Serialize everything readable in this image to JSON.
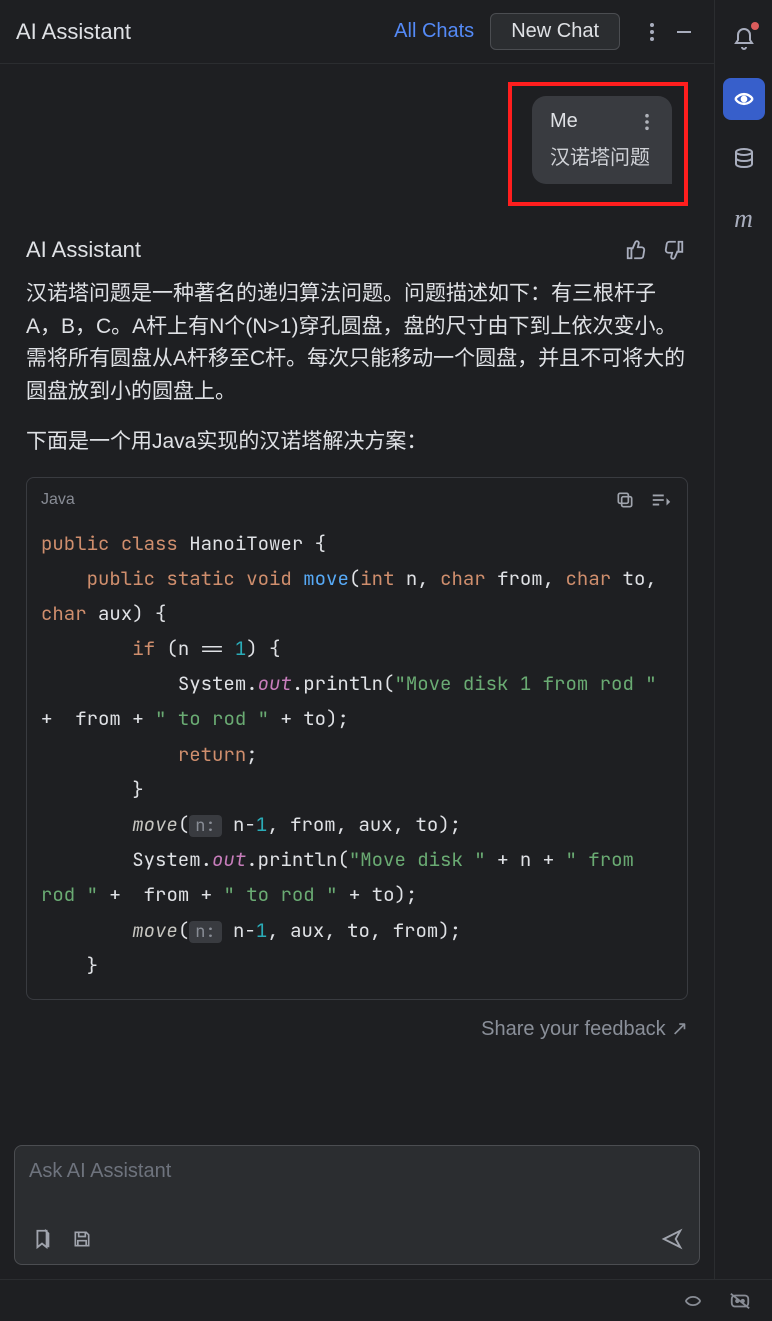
{
  "header": {
    "title": "AI Assistant",
    "all_chats": "All Chats",
    "new_chat": "New Chat"
  },
  "user_message": {
    "sender": "Me",
    "text": "汉诺塔问题"
  },
  "assistant": {
    "name": "AI Assistant",
    "paragraph1": "汉诺塔问题是一种著名的递归算法问题。问题描述如下：有三根杆子A，B，C。A杆上有N个(N>1)穿孔圆盘，盘的尺寸由下到上依次变小。需将所有圆盘从A杆移至C杆。每次只能移动一个圆盘，并且不可将大的圆盘放到小的圆盘上。",
    "paragraph2": "下面是一个用Java实现的汉诺塔解决方案：",
    "code_lang": "Java"
  },
  "code": {
    "kw_public": "public",
    "kw_class": "class",
    "cls_name": "HanoiTower",
    "brace_open": "{",
    "kw_static": "static",
    "kw_void": "void",
    "fn_move": "move",
    "kw_int": "int",
    "var_n": "n",
    "kw_char": "char",
    "var_from": "from",
    "var_to": "to",
    "var_aux": "aux",
    "kw_if": "if",
    "eq": "==",
    "num1": "1",
    "sys": "System",
    "out": "out",
    "println": "println",
    "str1": "\"Move disk 1 from rod \"",
    "plus": "+",
    "str2": "\" to rod \"",
    "kw_return": "return",
    "hint_n": "n:",
    "n_minus_1": "n-",
    "str3": "\"Move disk \"",
    "str4": "\" from rod \"",
    "brace_close": "}"
  },
  "feedback": "Share your feedback ↗",
  "input": {
    "placeholder": "Ask AI Assistant"
  }
}
